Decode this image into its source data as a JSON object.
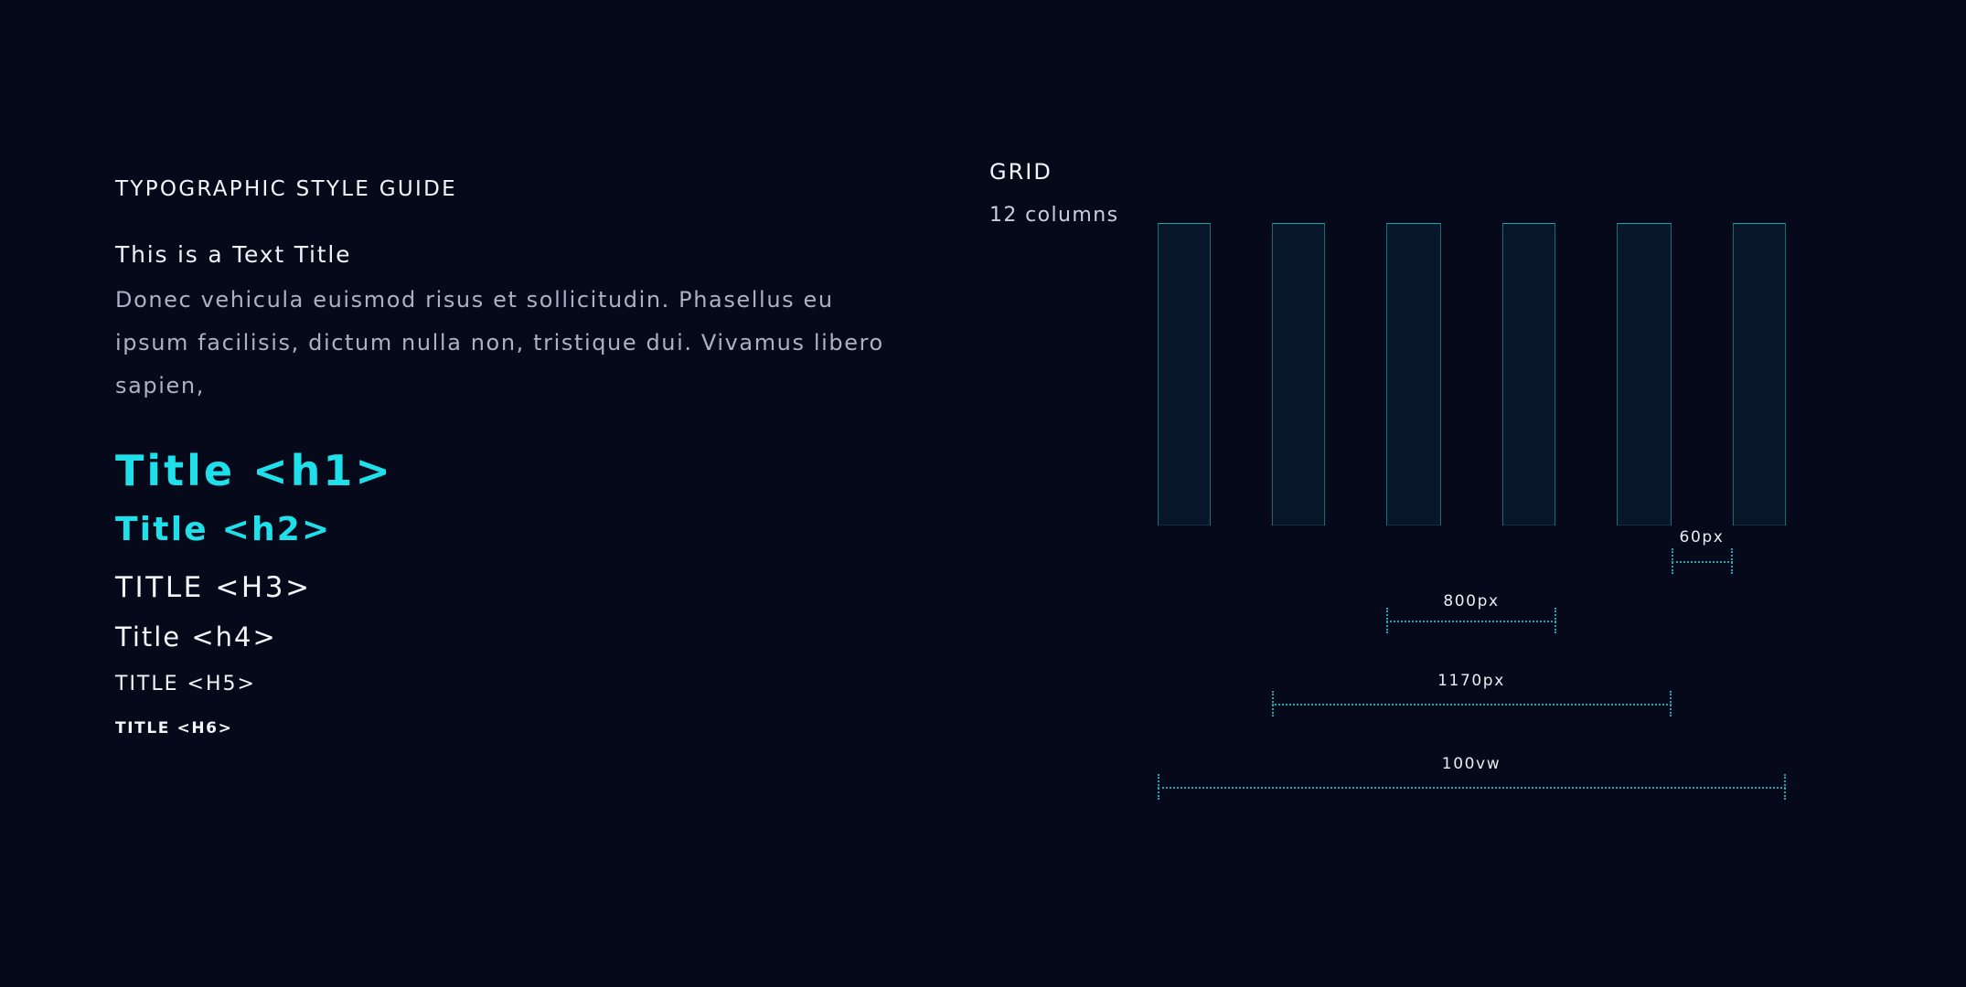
{
  "typography": {
    "heading": "TYPOGRAPHIC STYLE GUIDE",
    "text_title": "This is a Text Title",
    "body": "Donec vehicula euismod risus et sollicitudin. Phasellus eu ipsum facilisis, dictum nulla non, tristique dui. Vivamus libero sapien,",
    "h1": "Title <h1>",
    "h2": "Title <h2>",
    "h3": "TITLE <H3>",
    "h4": "Title <h4>",
    "h5": "TITLE <H5>",
    "h6": "TITLE <H6>"
  },
  "grid": {
    "heading": "GRID",
    "columns_label": "12 columns",
    "visible_columns": 6,
    "measurements": {
      "gutter": "60px",
      "content": "800px",
      "container": "1170px",
      "viewport": "100vw"
    }
  },
  "colors": {
    "background": "#050919",
    "accent": "#1fe0ea",
    "text": "#f2f5fa",
    "muted_text": "#aab3c4",
    "column_fill": "#08162a",
    "column_border": "#15a6ae",
    "measure_line": "#1ba7b8"
  }
}
